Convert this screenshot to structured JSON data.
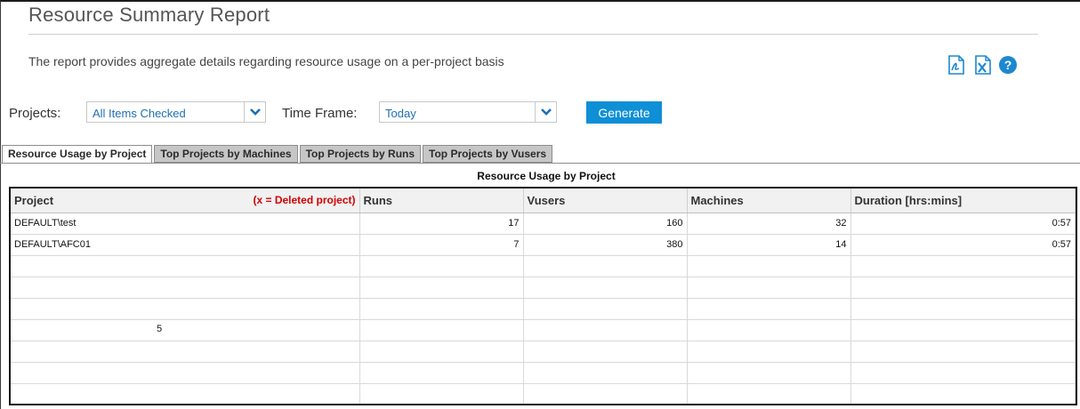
{
  "header": {
    "title": "Resource Summary Report",
    "description": "The report provides aggregate details regarding resource usage on a per-project basis"
  },
  "toolbar": {
    "icons": [
      "pdf-export-icon",
      "excel-export-icon",
      "help-icon"
    ]
  },
  "filters": {
    "projects_label": "Projects:",
    "projects_value": "All Items Checked",
    "timeframe_label": "Time Frame:",
    "timeframe_value": "Today",
    "generate_label": "Generate"
  },
  "tabs": [
    {
      "label": "Resource Usage by Project",
      "active": true
    },
    {
      "label": "Top Projects by Machines",
      "active": false
    },
    {
      "label": "Top Projects by Runs",
      "active": false
    },
    {
      "label": "Top Projects by Vusers",
      "active": false
    }
  ],
  "grid": {
    "title": "Resource Usage by Project",
    "deleted_note": "(x = Deleted project)",
    "columns": [
      "Project",
      "Runs",
      "Vusers",
      "Machines",
      "Duration [hrs:mins]"
    ],
    "rows": [
      [
        "DEFAULT\\test",
        "17",
        "160",
        "32",
        "0:57"
      ],
      [
        "DEFAULT\\AFC01",
        "7",
        "380",
        "14",
        "0:57"
      ]
    ],
    "stray_text": "5"
  },
  "colors": {
    "accent": "#0e8fd6",
    "link": "#1f6fb5",
    "deleted": "#d40000",
    "tab_inactive": "#c6c6c6"
  }
}
